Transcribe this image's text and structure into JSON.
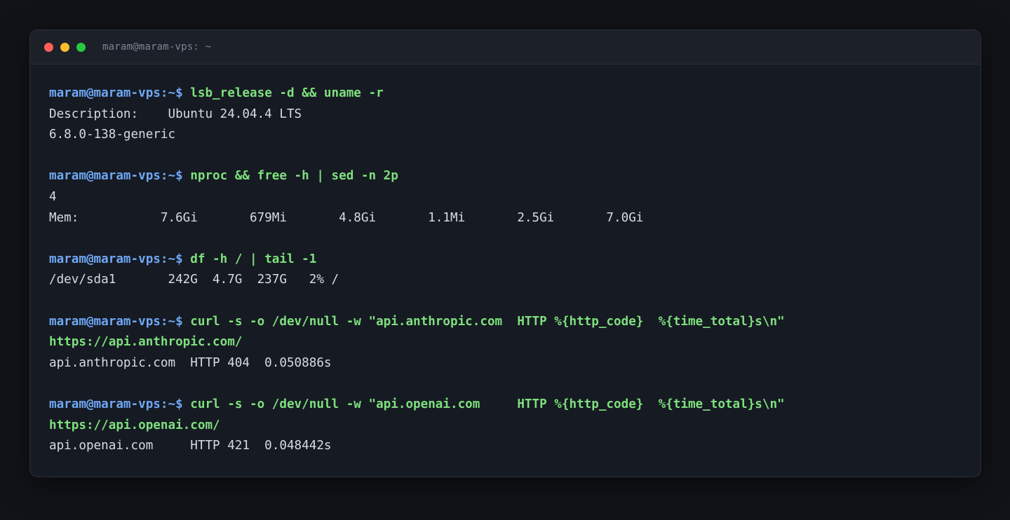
{
  "window": {
    "title": "maram@maram-vps: ~"
  },
  "colors": {
    "prompt": "#6ea8f5",
    "command": "#7ee07e",
    "output": "#d7dbe2",
    "close": "#ff5f57",
    "minimize": "#febc2e",
    "maximize": "#28c840"
  },
  "terminal": {
    "blocks": [
      {
        "prompt": "maram@maram-vps:~$",
        "command": " lsb_release -d && uname -r",
        "output": [
          {
            "type": "text",
            "text": "Description:    Ubuntu 24.04.4 LTS"
          },
          {
            "type": "text",
            "text": "6.8.0-138-generic"
          }
        ]
      },
      {
        "prompt": "maram@maram-vps:~$",
        "command": " nproc && free -h | sed -n 2p",
        "output": [
          {
            "type": "text",
            "text": "4"
          },
          {
            "type": "text",
            "text": "Mem:           7.6Gi       679Mi       4.8Gi       1.1Mi       2.5Gi       7.0Gi"
          }
        ]
      },
      {
        "prompt": "maram@maram-vps:~$",
        "command": " df -h / | tail -1",
        "output": [
          {
            "type": "text",
            "text": "/dev/sda1       242G  4.7G  237G   2% /"
          }
        ]
      },
      {
        "prompt": "maram@maram-vps:~$",
        "command": " curl -s -o /dev/null -w \"api.anthropic.com  HTTP %{http_code}  %{time_total}s\\n\"",
        "output": [
          {
            "type": "url",
            "text": "https://api.anthropic.com/"
          },
          {
            "type": "text",
            "text": "api.anthropic.com  HTTP 404  0.050886s"
          }
        ]
      },
      {
        "prompt": "maram@maram-vps:~$",
        "command": " curl -s -o /dev/null -w \"api.openai.com     HTTP %{http_code}  %{time_total}s\\n\"",
        "output": [
          {
            "type": "url",
            "text": "https://api.openai.com/"
          },
          {
            "type": "text",
            "text": "api.openai.com     HTTP 421  0.048442s"
          }
        ]
      }
    ]
  }
}
